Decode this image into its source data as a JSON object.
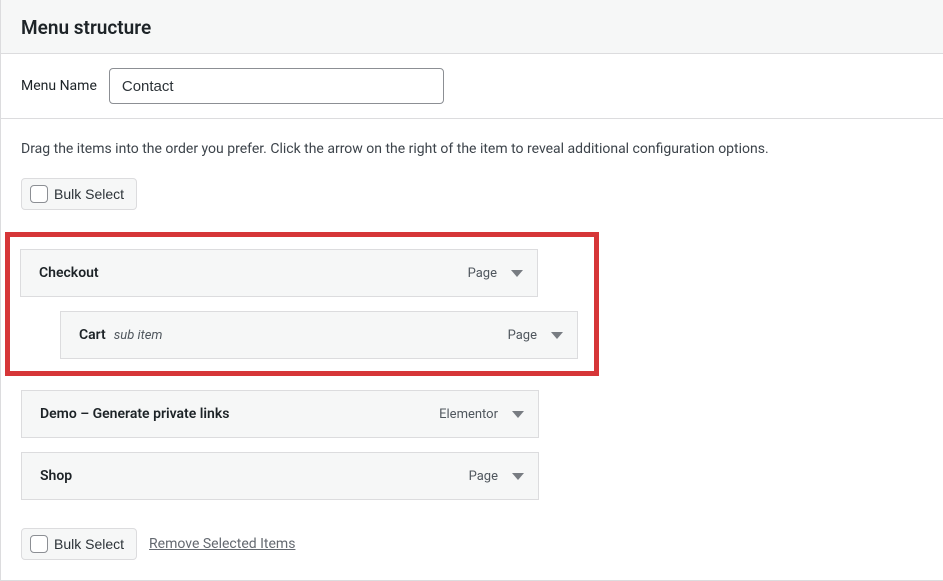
{
  "panel": {
    "title": "Menu structure"
  },
  "menu_name": {
    "label": "Menu Name",
    "value": "Contact"
  },
  "instructions": "Drag the items into the order you prefer. Click the arrow on the right of the item to reveal additional configuration options.",
  "bulk": {
    "select_label": "Bulk Select",
    "remove_label": "Remove Selected Items"
  },
  "items": [
    {
      "title": "Checkout",
      "type": "Page",
      "depth": 0,
      "subnote": ""
    },
    {
      "title": "Cart",
      "type": "Page",
      "depth": 1,
      "subnote": "sub item"
    },
    {
      "title": "Demo – Generate private links",
      "type": "Elementor",
      "depth": 0,
      "subnote": ""
    },
    {
      "title": "Shop",
      "type": "Page",
      "depth": 0,
      "subnote": ""
    }
  ]
}
